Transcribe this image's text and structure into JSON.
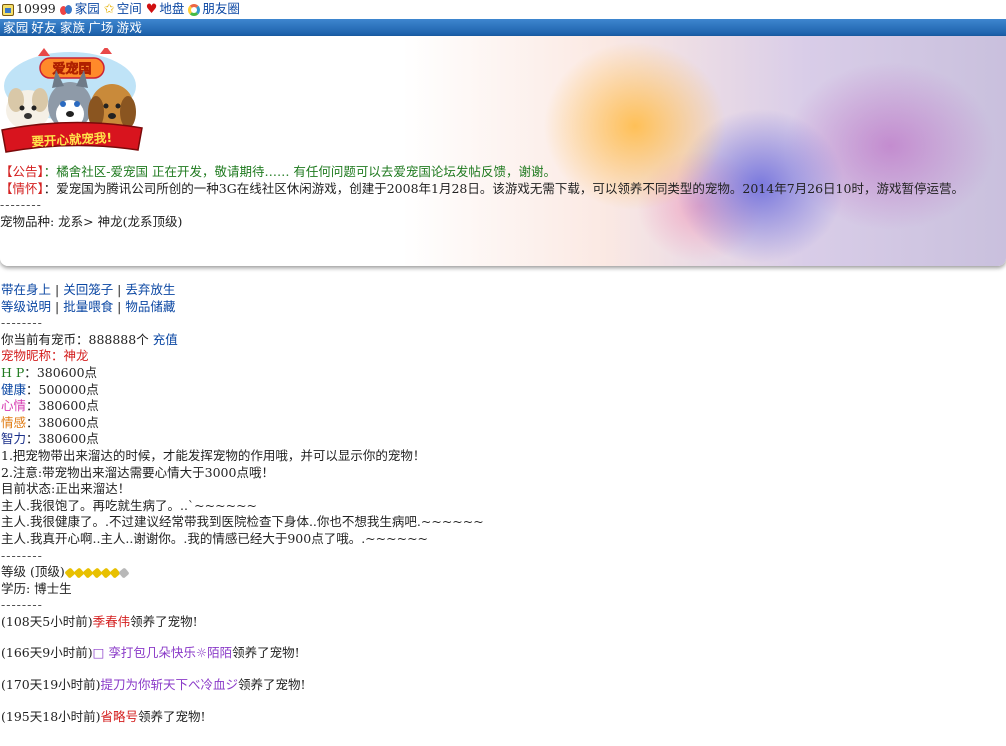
{
  "topbar": {
    "user_id": "10999",
    "links": [
      "家园",
      "空间",
      "地盘",
      "朋友圈"
    ]
  },
  "nav": [
    "家园",
    "好友",
    "家族",
    "广场",
    "游戏"
  ],
  "logo": {
    "title": "爱宠国",
    "slogan": "要开心就宠我!"
  },
  "notices": [
    {
      "tag": "【公告】",
      "text": "：橘舍社区-爱宠国 正在开发，敬请期待…… 有任何问题可以去爱宠国论坛发帖反馈，谢谢。"
    },
    {
      "tag": "【情怀】",
      "text": "：爱宠国为腾讯公司所创的一种3G在线社区休闲游戏，创建于2008年1月28日。该游戏无需下载，可以领养不同类型的宠物。2014年7月26日10时，游戏暂停运营。"
    }
  ],
  "separator": "--------",
  "pet_breed": "宠物品种: 龙系> 神龙(龙系顶级)",
  "actions_row1": [
    "带在身上",
    "关回笼子",
    "丢弃放生"
  ],
  "actions_row2": [
    "等级说明",
    "批量喂食",
    "物品储藏"
  ],
  "coins": {
    "label": "你当前有宠币：888888个",
    "recharge": "充值"
  },
  "stats": {
    "nickname_label": "宠物昵称",
    "nickname": "神龙",
    "hp_label": "H P",
    "hp": "380600点",
    "health_label": "健康",
    "health": "500000点",
    "mood_label": "心情",
    "mood": "380600点",
    "emotion_label": "情感",
    "emotion": "380600点",
    "iq_label": "智力",
    "iq": "380600点"
  },
  "tips": [
    "1.把宠物带出来溜达的时候，才能发挥宠物的作用哦，并可以显示你的宠物！",
    "2.注意:带宠物出来溜达需要心情大于3000点哦！",
    "目前状态:正出来溜达！",
    "主人.我很饱了。再吃就生病了。..`~~~~~~",
    "主人.我很健康了。.不过建议经常带我到医院检查下身体..你也不想我生病吧.~~~~~~",
    "主人.我真开心啊..主人..谢谢你。.我的情感已经大于900点了哦。.~~~~~~"
  ],
  "level": {
    "label": "等级 (顶级)",
    "bones_full": 6,
    "bones_total": 7
  },
  "education": "学历: 博士生",
  "adoptions": [
    {
      "time": "(108天5小时前)",
      "name": "季春伟",
      "suffix": "领养了宠物!",
      "color": "red"
    },
    {
      "time": "(166天9小时前)",
      "name": "□ 孪打包几朵快乐☼陌陌",
      "suffix": "领养了宠物!",
      "color": "purple"
    },
    {
      "time": "(170天19小时前)",
      "name": "提刀为你斩天下べ冷血ジ",
      "suffix": "领养了宠物!",
      "color": "purple"
    },
    {
      "time": "(195天18小时前)",
      "name": "省略号",
      "suffix": "领养了宠物!",
      "color": "red"
    }
  ]
}
